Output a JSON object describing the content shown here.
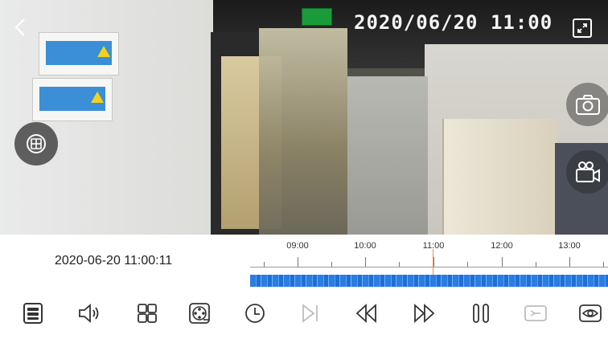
{
  "video": {
    "osd_timestamp": "2020/06/20 11:00",
    "controls": [
      {
        "icon": "back-chevron-icon"
      },
      {
        "icon": "fullscreen-icon"
      },
      {
        "icon": "camera-icon"
      },
      {
        "icon": "video-camera-icon"
      },
      {
        "icon": "multi-screen-icon"
      }
    ]
  },
  "timeline": {
    "current_time": "2020-06-20 11:00:11",
    "hour_labels": [
      "09:00",
      "10:00",
      "11:00",
      "12:00",
      "13:00"
    ],
    "recording_color": "#2a7de1",
    "cursor_color": "#ff8c3a"
  },
  "toolbar": {
    "icons": [
      "storage-icon",
      "volume-icon",
      "layout-grid-icon",
      "film-reel-icon",
      "clock-icon",
      "next-frame-icon",
      "rewind-icon",
      "fast-forward-icon",
      "pause-icon",
      "hd-icon",
      "eye-icon"
    ]
  }
}
